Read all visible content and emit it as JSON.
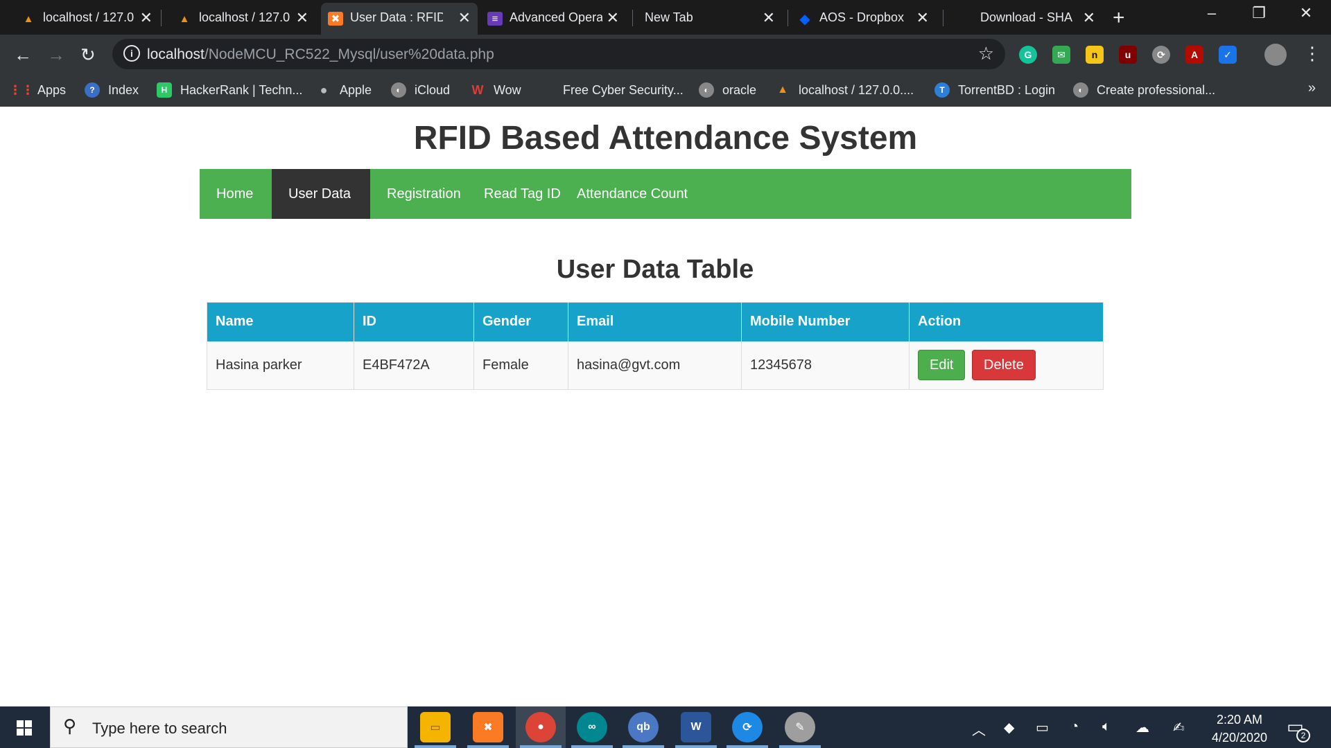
{
  "browser": {
    "tabs": [
      {
        "title": "localhost / 127.0",
        "icon": "phpmyadmin-icon"
      },
      {
        "title": "localhost / 127.0",
        "icon": "phpmyadmin-icon"
      },
      {
        "title": "User Data : RFID",
        "icon": "xampp-icon"
      },
      {
        "title": "Advanced Opera",
        "icon": "forms-icon"
      },
      {
        "title": "New Tab",
        "icon": ""
      },
      {
        "title": "AOS - Dropbox",
        "icon": "dropbox-icon"
      },
      {
        "title": "Download - SHA",
        "icon": ""
      }
    ],
    "active_tab": 2,
    "url_host": "localhost",
    "url_path": "/NodeMCU_RC522_Mysql/user%20data.php",
    "bookmarks": [
      {
        "label": "Apps"
      },
      {
        "label": "Index"
      },
      {
        "label": "HackerRank | Techn..."
      },
      {
        "label": "Apple"
      },
      {
        "label": "iCloud"
      },
      {
        "label": "Wow"
      },
      {
        "label": "Free Cyber Security..."
      },
      {
        "label": "oracle"
      },
      {
        "label": "localhost / 127.0.0...."
      },
      {
        "label": "TorrentBD : Login"
      },
      {
        "label": "Create professional..."
      }
    ],
    "more_bookmarks": "»"
  },
  "site": {
    "title": "RFID Based Attendance System",
    "nav": [
      {
        "label": "Home"
      },
      {
        "label": "User Data"
      },
      {
        "label": "Registration"
      },
      {
        "label": "Read Tag ID"
      },
      {
        "label": "Attendance Count"
      }
    ],
    "active_nav": 1,
    "accent_color": "#4CAF50",
    "table_header_color": "#17A2C9"
  },
  "table": {
    "title": "User Data Table",
    "columns": [
      "Name",
      "ID",
      "Gender",
      "Email",
      "Mobile Number",
      "Action"
    ],
    "rows": [
      {
        "name": "Hasina parker",
        "id": "E4BF472A",
        "gender": "Female",
        "email": "hasina@gvt.com",
        "mobile": "12345678"
      }
    ],
    "edit_label": "Edit",
    "delete_label": "Delete"
  },
  "taskbar": {
    "search_placeholder": "Type here to search",
    "apps": [
      "file-explorer-icon",
      "xampp-icon",
      "chrome-icon",
      "arduino-icon",
      "qbittorrent-icon",
      "word-icon",
      "sync-icon",
      "paint-icon"
    ],
    "time": "2:20 AM",
    "date": "4/20/2020",
    "notifications": "2"
  }
}
